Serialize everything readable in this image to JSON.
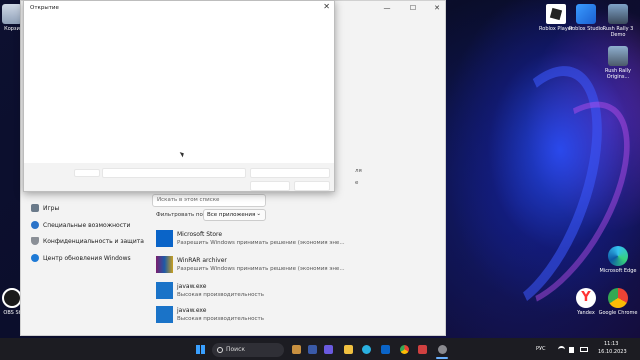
{
  "desktop": {
    "icons": [
      {
        "label": "Корзи"
      },
      {
        "label": "Roblox Player"
      },
      {
        "label": "Roblox Studio"
      },
      {
        "label": "Rush Rally 3 Demo"
      },
      {
        "label": "Rush Rally Origins..."
      },
      {
        "label": "OBS St"
      },
      {
        "label": "Microsoft Edge"
      },
      {
        "label": "Yandex"
      },
      {
        "label": "Google Chrome"
      }
    ]
  },
  "settings": {
    "sidebar": [
      {
        "label": "Игры"
      },
      {
        "label": "Специальные возможности"
      },
      {
        "label": "Конфиденциальность и защита"
      },
      {
        "label": "Центр обновления Windows"
      }
    ],
    "search_placeholder": "Искать в этом списке",
    "filter_label": "Фильтровать по:",
    "filter_value": "Все приложения",
    "filter_arrow": "⌄",
    "bg_partial_1": "ля",
    "bg_partial_2": "е",
    "apps": [
      {
        "name": "Microsoft Store",
        "desc": "Разрешить Windows принимать решение (экономия эне..."
      },
      {
        "name": "WinRAR archiver",
        "desc": "Разрешить Windows принимать решение (экономия эне..."
      },
      {
        "name": "javaw.exe",
        "desc": "Высокая производительность"
      },
      {
        "name": "javaw.exe",
        "desc": "Высокая производительность"
      }
    ]
  },
  "dialog": {
    "title": "Открытие",
    "close_glyph": "✕"
  },
  "window_controls": {
    "minimize": "—",
    "maximize": "☐",
    "close": "✕"
  },
  "taskbar": {
    "search_label": "Поиск",
    "language": "РУС",
    "time": "11:13",
    "date": "16.10.2023"
  }
}
